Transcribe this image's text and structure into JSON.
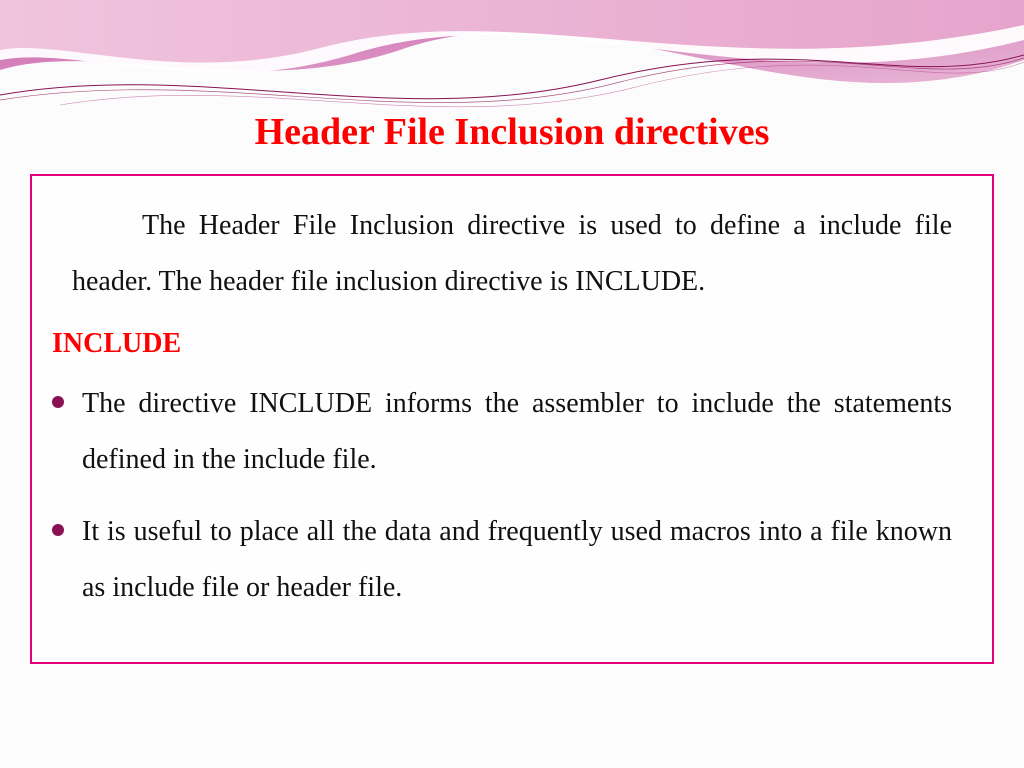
{
  "title": "Header File Inclusion directives",
  "intro": "The Header File Inclusion directive is used to define a include file header. The header file inclusion directive is INCLUDE.",
  "subhead": "INCLUDE",
  "bullets": [
    "The directive INCLUDE informs the assembler to include the statements defined in the include file.",
    "It is useful to place all the data and frequently used macros into a file known as include file or header file."
  ]
}
